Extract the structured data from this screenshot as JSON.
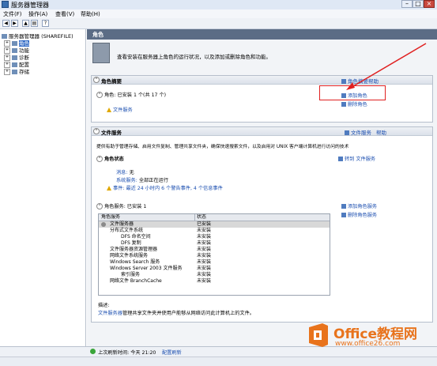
{
  "window": {
    "title": "服务器管理器"
  },
  "menus": [
    "文件(F)",
    "操作(A)",
    "查看(V)",
    "帮助(H)"
  ],
  "tree": {
    "root": "服务器管理器 (SHAREFILE)",
    "items": [
      {
        "label": "角色",
        "selected": true
      },
      {
        "label": "功能",
        "selected": false
      },
      {
        "label": "诊断",
        "selected": false
      },
      {
        "label": "配置",
        "selected": false
      },
      {
        "label": "存储",
        "selected": false
      }
    ]
  },
  "pane": {
    "header": "角色",
    "description": "查看安装在服务器上角色的运行状况，以及添加或删除角色和功能。"
  },
  "roles_summary": {
    "title": "角色摘要",
    "help_link": "角色摘要帮助",
    "count_text": "角色: 已安装 1 个(共 17 个)",
    "installed_role": "文件服务",
    "add_role": "添加角色",
    "remove_role": "删除角色"
  },
  "file_services": {
    "title": "文件服务",
    "header_link1": "文件服务",
    "header_link2": "帮助",
    "description": "提供有助于管理存储、启用文件复制、管理共享文件夹，确保快速搜索文件，以及启用对 UNIX 客户端计算机进行访问的技术",
    "status": {
      "title": "角色状态",
      "goto_link": "转到 文件服务",
      "messages_label": "消息:",
      "messages_value": "无",
      "system_services_label": "系统服务:",
      "system_services_value": "全部正在运行",
      "events_label": "事件:",
      "events_value": "最近 24 小时内 6 个警告事件, 4 个信息事件"
    },
    "services": {
      "title": "角色服务: 已安装 1",
      "add_link": "添加角色服务",
      "remove_link": "删除角色服务",
      "columns": [
        "角色服务",
        "状态"
      ],
      "rows": [
        {
          "name": "文件服务器",
          "status": "已安装",
          "indent": 1
        },
        {
          "name": "分布式文件系统",
          "status": "未安装",
          "indent": 1
        },
        {
          "name": "DFS 命名空间",
          "status": "未安装",
          "indent": 2
        },
        {
          "name": "DFS 复制",
          "status": "未安装",
          "indent": 2
        },
        {
          "name": "文件服务器资源管理器",
          "status": "未安装",
          "indent": 1
        },
        {
          "name": "网络文件系统服务",
          "status": "未安装",
          "indent": 1
        },
        {
          "name": "Windows Search 服务",
          "status": "未安装",
          "indent": 1
        },
        {
          "name": "Windows Server 2003 文件服务",
          "status": "未安装",
          "indent": 1
        },
        {
          "name": "索引服务",
          "status": "未安装",
          "indent": 2
        },
        {
          "name": "网络文件 BranchCache",
          "status": "未安装",
          "indent": 1
        }
      ]
    },
    "description_label": "描述:",
    "description_link": "文件服务器",
    "description_text": "管理共享文件夹并使用户能够从网络访问此计算机上的文件。"
  },
  "statusbar": {
    "refresh_label": "上次刷新时间: 今天 21:20",
    "configure": "配置刷新"
  },
  "watermark": {
    "brand": "Office教程网",
    "url": "www.office26.com"
  },
  "colors": {
    "annotation": "#e02020",
    "link": "#1c4fb0",
    "header": "#5b6c85",
    "brand_orange": "#e8731c"
  }
}
